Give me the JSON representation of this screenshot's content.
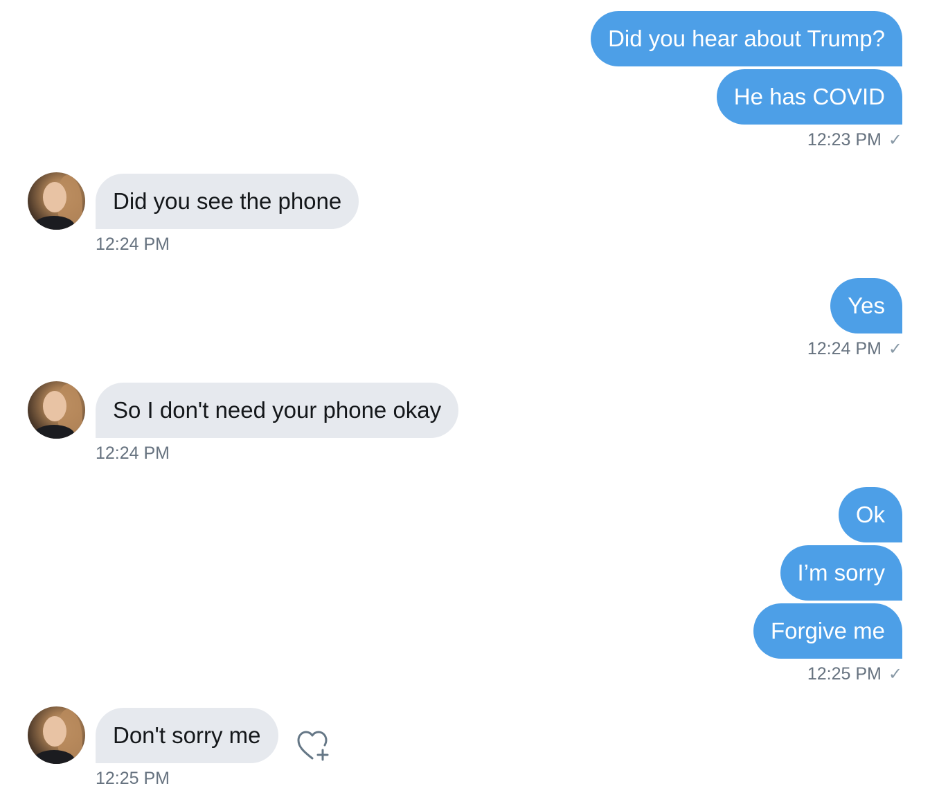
{
  "messages": [
    {
      "text": "Did you hear about Trump?"
    },
    {
      "text": "He has COVID"
    },
    {
      "text": "Did you see the phone"
    },
    {
      "text": "Yes"
    },
    {
      "text": "So I don't need your phone okay"
    },
    {
      "text": "Ok"
    },
    {
      "text": "I’m sorry"
    },
    {
      "text": "Forgive me"
    },
    {
      "text": "Don't sorry me"
    }
  ],
  "timestamps": [
    {
      "time": "12:23 PM",
      "check": "✓"
    },
    {
      "time": "12:24 PM"
    },
    {
      "time": "12:24 PM",
      "check": "✓"
    },
    {
      "time": "12:24 PM"
    },
    {
      "time": "12:25 PM",
      "check": "✓"
    },
    {
      "time": "12:25 PM"
    }
  ],
  "icons": {
    "read_receipt": "checkmark-icon",
    "reaction": "heart-plus-icon",
    "avatar": "avatar"
  },
  "colors": {
    "outgoing_bubble": "#4d9fe7",
    "incoming_bubble": "#e6e9ee",
    "timestamp": "#66727f"
  }
}
